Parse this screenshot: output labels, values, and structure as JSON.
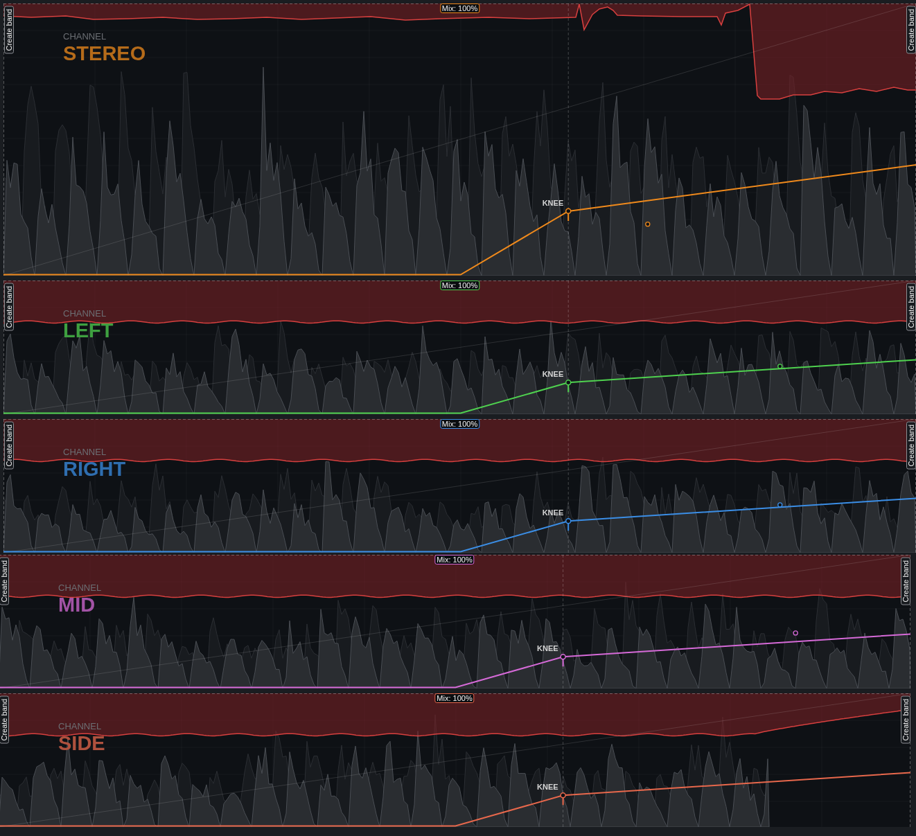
{
  "channels": [
    {
      "kind": "burst",
      "label": "CHANNEL",
      "name": "STEREO",
      "color": "#f08a1c",
      "mix": "Mix: 100%",
      "knee": "KNEE",
      "create_band": [
        "Create band",
        "Create band"
      ],
      "control_point": true
    },
    {
      "kind": "steady",
      "label": "CHANNEL",
      "name": "LEFT",
      "color": "#4fd24f",
      "mix": "Mix: 100%",
      "knee": "KNEE",
      "create_band": [
        "Create band",
        "Create band"
      ],
      "control_point": true
    },
    {
      "kind": "steady",
      "label": "CHANNEL",
      "name": "RIGHT",
      "color": "#3b8ee6",
      "mix": "Mix: 100%",
      "knee": "KNEE",
      "create_band": [
        "Create band",
        "Create band"
      ],
      "control_point": true
    },
    {
      "kind": "steady",
      "label": "CHANNEL",
      "name": "MID",
      "color": "#d66ad8",
      "mix": "Mix: 100%",
      "knee": "KNEE",
      "create_band": [
        "Create band",
        "Create band"
      ],
      "control_point": true
    },
    {
      "kind": "fade",
      "label": "CHANNEL",
      "name": "SIDE",
      "color": "#e8684c",
      "mix": "Mix: 100%",
      "knee": "KNEE",
      "create_band": [
        "Create band",
        "Create band"
      ],
      "control_point": false
    }
  ]
}
